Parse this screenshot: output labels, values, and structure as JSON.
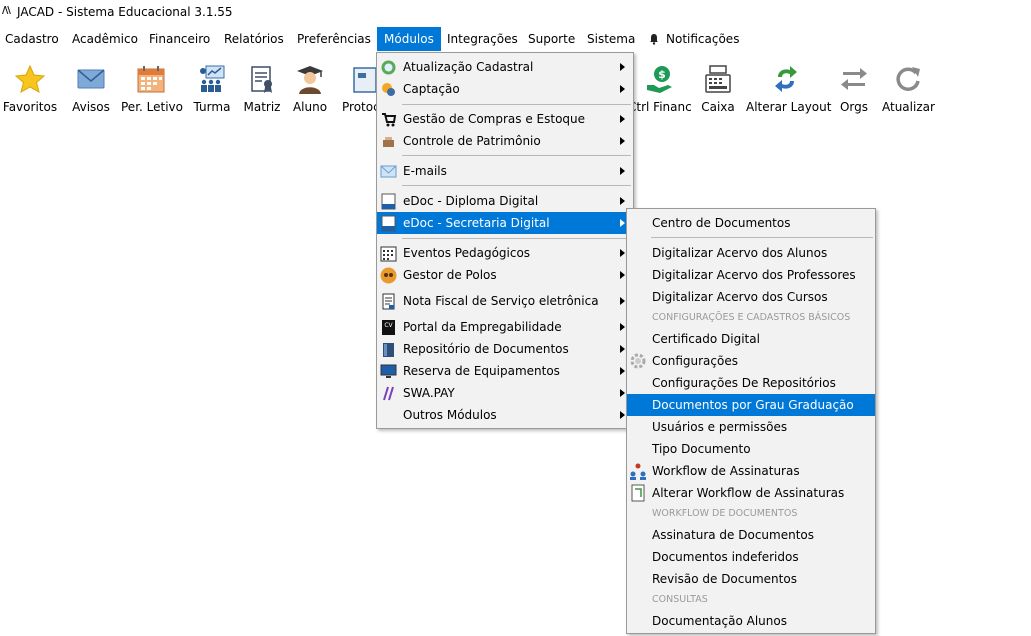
{
  "window": {
    "app_logo": "/\\\\",
    "title": "JACAD - Sistema Educacional 3.1.55"
  },
  "menubar": {
    "items": [
      "Cadastro",
      "Acadêmico",
      "Financeiro",
      "Relatórios",
      "Preferências",
      "Módulos",
      "Integrações",
      "Suporte",
      "Sistema",
      "Notificações"
    ],
    "active": "Módulos"
  },
  "toolbar": {
    "buttons": [
      {
        "label": "Favoritos",
        "icon": "star-icon"
      },
      {
        "label": "Avisos",
        "icon": "envelope-icon"
      },
      {
        "label": "Per. Letivo",
        "icon": "calendar-icon"
      },
      {
        "label": "Turma",
        "icon": "classroom-icon"
      },
      {
        "label": "Matriz",
        "icon": "document-ribbon-icon"
      },
      {
        "label": "Aluno",
        "icon": "graduate-icon"
      },
      {
        "label": "Protoc",
        "icon": "protocol-icon"
      },
      {
        "label": "Ctrl Financ.",
        "icon": "money-hand-icon"
      },
      {
        "label": "Caixa",
        "icon": "cash-register-icon"
      },
      {
        "label": "Alterar Layout",
        "icon": "recycle-arrows-icon"
      },
      {
        "label": "Orgs",
        "icon": "swap-arrows-icon"
      },
      {
        "label": "Atualizar",
        "icon": "refresh-icon"
      }
    ]
  },
  "modulos_menu": {
    "items": [
      {
        "label": "Atualização Cadastral",
        "icon": "refresh-globe-icon"
      },
      {
        "label": "Captação",
        "icon": "magnet-icon"
      },
      {
        "label": "Gestão de Compras e Estoque",
        "icon": "cart-icon"
      },
      {
        "label": "Controle de Patrimônio",
        "icon": "box-icon"
      },
      {
        "label": "E-mails",
        "icon": "email-icon"
      },
      {
        "label": "eDoc - Diploma Digital",
        "icon": "edoc-icon"
      },
      {
        "label": "eDoc - Secretaria Digital",
        "icon": "edoc-icon"
      },
      {
        "label": "Eventos Pedagógicos",
        "icon": "calendar-grid-icon"
      },
      {
        "label": "Gestor de Polos",
        "icon": "users-circle-icon"
      },
      {
        "label": "Nota Fiscal de Serviço eletrônica",
        "icon": "invoice-icon"
      },
      {
        "label": "Portal da Empregabilidade",
        "icon": "cv-icon"
      },
      {
        "label": "Repositório de Documentos",
        "icon": "book-icon"
      },
      {
        "label": "Reserva de Equipamentos",
        "icon": "monitor-icon"
      },
      {
        "label": "SWA.PAY",
        "icon": "swapay-icon"
      },
      {
        "label": "Outros Módulos",
        "icon": ""
      }
    ],
    "highlighted": "eDoc - Secretaria Digital"
  },
  "secretaria_submenu": {
    "items": [
      {
        "label": "Centro de Documentos"
      },
      {
        "label": "Digitalizar Acervo dos Alunos"
      },
      {
        "label": "Digitalizar Acervo dos Professores"
      },
      {
        "label": "Digitalizar Acervo dos Cursos"
      },
      {
        "category": "CONFIGURAÇÕES E CADASTROS BÁSICOS"
      },
      {
        "label": "Certificado Digital"
      },
      {
        "label": "Configurações",
        "icon": "gear-icon"
      },
      {
        "label": "Configurações De Repositórios"
      },
      {
        "label": "Documentos por Grau Graduação"
      },
      {
        "label": "Usuários e permissões"
      },
      {
        "label": "Tipo Documento"
      },
      {
        "label": "Workflow de Assinaturas",
        "icon": "workflow-users-icon"
      },
      {
        "label": "Alterar Workflow de Assinaturas",
        "icon": "workflow-edit-icon"
      },
      {
        "category": "WORKFLOW DE DOCUMENTOS"
      },
      {
        "label": "Assinatura de Documentos"
      },
      {
        "label": "Documentos indeferidos"
      },
      {
        "label": "Revisão de Documentos"
      },
      {
        "category": "CONSULTAS"
      },
      {
        "label": "Documentação Alunos"
      }
    ],
    "highlighted": "Documentos por Grau Graduação"
  },
  "colors": {
    "highlight": "#0078d7",
    "menu_bg": "#f2f2f2",
    "category_text": "#9a9a9a"
  }
}
